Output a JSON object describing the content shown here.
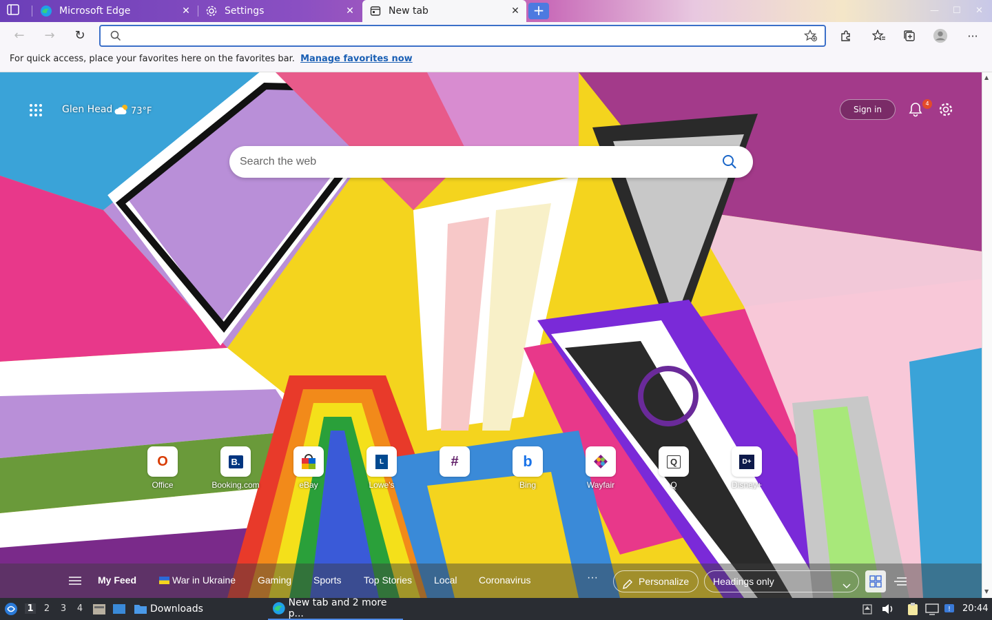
{
  "tabs": [
    {
      "title": "Microsoft Edge",
      "icon": "edge-icon"
    },
    {
      "title": "Settings",
      "icon": "gear-icon"
    },
    {
      "title": "New tab",
      "icon": "newtab-icon",
      "active": true
    }
  ],
  "toolbar": {
    "address_value": ""
  },
  "favbar": {
    "message": "For quick access, place your favorites here on the favorites bar.",
    "link": "Manage favorites now"
  },
  "ntp": {
    "user_name": "Glen Head",
    "weather": "73°F",
    "sign_in": "Sign in",
    "notification_count": "4",
    "search_placeholder": "Search the web"
  },
  "tiles": [
    {
      "label": "Office",
      "glyph": "O",
      "color": "#d83b01"
    },
    {
      "label": "Booking.com",
      "glyph": "B.",
      "color": "#003580"
    },
    {
      "label": "eBay",
      "glyph": "e",
      "color": "#e53238"
    },
    {
      "label": "Lowe's",
      "glyph": "L",
      "color": "#004990"
    },
    {
      "label": "",
      "glyph": "#",
      "color": "#611f69"
    },
    {
      "label": "Bing",
      "glyph": "b",
      "color": "#1a73e8"
    },
    {
      "label": "Wayfair",
      "glyph": "W",
      "color": "#7f187f"
    },
    {
      "label": "Q",
      "glyph": "Q",
      "color": "#333333"
    },
    {
      "label": "Disney+",
      "glyph": "D+",
      "color": "#113ccf"
    }
  ],
  "feed": {
    "items": [
      "My Feed",
      "War in Ukraine",
      "Gaming",
      "Sports",
      "Top Stories",
      "Local",
      "Coronavirus"
    ],
    "more": "···",
    "personalize": "Personalize",
    "layout_select": "Headings only"
  },
  "taskbar": {
    "workspaces": [
      "1",
      "2",
      "3",
      "4"
    ],
    "folder": "Downloads",
    "task": "New tab and 2 more p...",
    "clock": "20:44"
  }
}
